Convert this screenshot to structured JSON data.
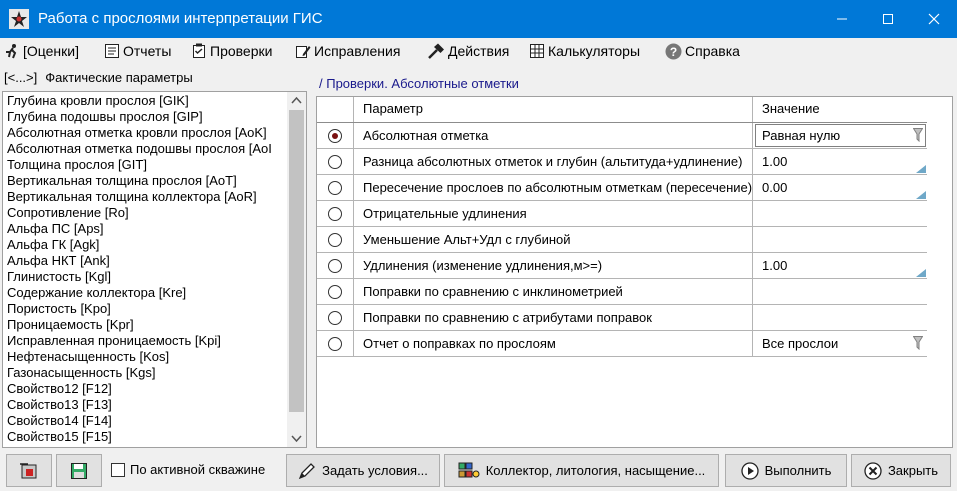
{
  "window": {
    "title": "Работа с прослоями интерпретации ГИС",
    "controls": {
      "minimize": "minimize",
      "maximize": "maximize",
      "close": "close"
    }
  },
  "menu": [
    {
      "label": "[Оценки]",
      "icon": "runner-icon"
    },
    {
      "label": "Отчеты",
      "icon": "report-icon"
    },
    {
      "label": "Проверки",
      "icon": "checklist-icon"
    },
    {
      "label": "Исправления",
      "icon": "pencil-icon"
    },
    {
      "label": "Действия",
      "icon": "hammer-icon"
    },
    {
      "label": "Калькуляторы",
      "icon": "calculator-icon"
    },
    {
      "label": "Справка",
      "icon": "help-icon"
    }
  ],
  "left_panel": {
    "nav": "[<...>]",
    "header": "Фактические параметры",
    "items": [
      "Глубина кровли прослоя [GIK]",
      "Глубина подошвы прослоя [GIP]",
      "Абсолютная отметка кровли прослоя [AoK]",
      "Абсолютная отметка подошвы прослоя [AoI",
      "Толщина прослоя [GIT]",
      "Вертикальная толщина прослоя [AoT]",
      "Вертикальная толщина коллектора [AoR]",
      "Сопротивление [Ro]",
      "Альфа ПС [Aps]",
      "Альфа ГК [Agk]",
      "Альфа НКТ [Ank]",
      "Глинистость [Kgl]",
      "Содержание коллектора [Kre]",
      "Пористость [Kpo]",
      "Проницаемость [Kpr]",
      "Исправленная проницаемость [Kpi]",
      "Нефтенасыщенность [Kos]",
      "Газонасыщенность [Kgs]",
      "Свойство12 [F12]",
      "Свойство13 [F13]",
      "Свойство14 [F14]",
      "Свойство15 [F15]"
    ]
  },
  "right_panel": {
    "header": "/ Проверки. Абсолютные отметки",
    "columns": {
      "param": "Параметр",
      "value": "Значение"
    },
    "rows": [
      {
        "param": "Абсолютная отметка",
        "value": "Равная нулю",
        "selected": true,
        "editor": "dropdown"
      },
      {
        "param": "Разница абсолютных отметок и глубин (альтитуда+удлинение)",
        "value": "1.00",
        "selected": false,
        "editor": "numeric"
      },
      {
        "param": "Пересечение прослоев по абсолютным отметкам (пересечение)",
        "value": "0.00",
        "selected": false,
        "editor": "numeric"
      },
      {
        "param": "Отрицательные удлинения",
        "value": "",
        "selected": false,
        "editor": "none"
      },
      {
        "param": "Уменьшение Альт+Удл с глубиной",
        "value": "",
        "selected": false,
        "editor": "none"
      },
      {
        "param": "Удлинения (изменение удлинения,м>=)",
        "value": "1.00",
        "selected": false,
        "editor": "numeric"
      },
      {
        "param": "Поправки по сравнению с инклинометрией",
        "value": "",
        "selected": false,
        "editor": "none"
      },
      {
        "param": "Поправки по сравнению с атрибутами поправок",
        "value": "",
        "selected": false,
        "editor": "none"
      },
      {
        "param": "Отчет о поправках по прослоям",
        "value": "Все прослои",
        "selected": false,
        "editor": "dropdown"
      }
    ]
  },
  "bottom": {
    "checkbox_label": "По активной скважине",
    "checkbox_checked": false,
    "set_conditions": "Задать условия...",
    "collector": "Коллектор, литология, насыщение...",
    "run": "Выполнить",
    "close": "Закрыть"
  },
  "colors": {
    "titlebar": "#0078d7",
    "header_text": "#1a1a8c",
    "radio_dot": "#7a1010"
  }
}
